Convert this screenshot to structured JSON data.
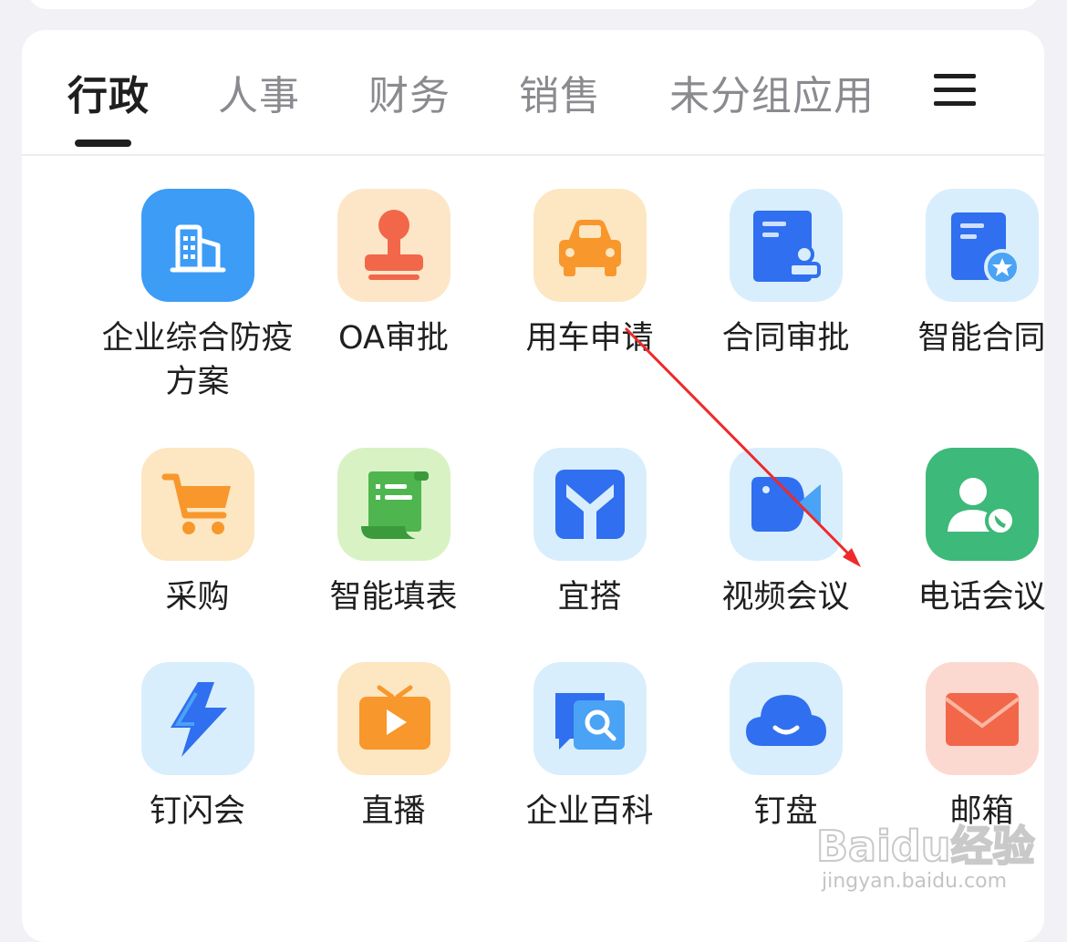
{
  "tabs": [
    {
      "label": "行政",
      "active": true
    },
    {
      "label": "人事"
    },
    {
      "label": "财务"
    },
    {
      "label": "销售"
    },
    {
      "label": "未分组应用"
    }
  ],
  "apps": [
    {
      "label": "企业综合防疫方案",
      "icon": "building-icon"
    },
    {
      "label": "OA审批",
      "icon": "stamp-icon"
    },
    {
      "label": "用车申请",
      "icon": "car-icon"
    },
    {
      "label": "合同审批",
      "icon": "contract-approval-icon"
    },
    {
      "label": "智能合同",
      "icon": "smart-contract-icon"
    },
    {
      "label": "采购",
      "icon": "shopping-cart-icon"
    },
    {
      "label": "智能填表",
      "icon": "scroll-form-icon"
    },
    {
      "label": "宜搭",
      "icon": "yida-icon"
    },
    {
      "label": "视频会议",
      "icon": "video-camera-icon"
    },
    {
      "label": "电话会议",
      "icon": "phone-contact-icon"
    },
    {
      "label": "钉闪会",
      "icon": "lightning-icon"
    },
    {
      "label": "直播",
      "icon": "tv-play-icon"
    },
    {
      "label": "企业百科",
      "icon": "chat-search-icon"
    },
    {
      "label": "钉盘",
      "icon": "cloud-icon"
    },
    {
      "label": "邮箱",
      "icon": "mail-envelope-icon"
    }
  ],
  "watermark": {
    "main": "Baidu经验",
    "sub": "jingyan.baidu.com"
  },
  "colors": {
    "annotation_arrow": "#ee2a2a",
    "text": "#1f1f1f",
    "tab_inactive": "#8a8a8f"
  }
}
